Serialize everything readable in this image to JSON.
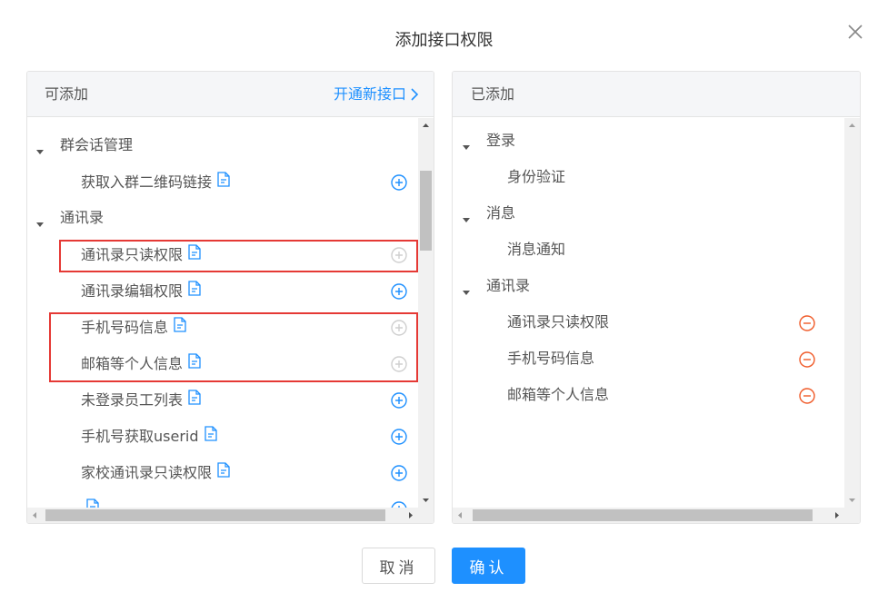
{
  "dialog": {
    "title": "添加接口权限",
    "cancel_label": "取消",
    "confirm_label": "确认"
  },
  "left_panel": {
    "title": "可添加",
    "link_label": "开通新接口",
    "rows": [
      {
        "type": "item",
        "label": "",
        "addable": true
      },
      {
        "type": "group",
        "label": "群会话管理"
      },
      {
        "type": "item",
        "label": "获取入群二维码链接",
        "addable": true
      },
      {
        "type": "group",
        "label": "通讯录"
      },
      {
        "type": "item",
        "label": "通讯录只读权限",
        "addable": false
      },
      {
        "type": "item",
        "label": "通讯录编辑权限",
        "addable": true
      },
      {
        "type": "item",
        "label": "手机号码信息",
        "addable": false
      },
      {
        "type": "item",
        "label": "邮箱等个人信息",
        "addable": false
      },
      {
        "type": "item",
        "label": "未登录员工列表",
        "addable": true
      },
      {
        "type": "item",
        "label": "手机号获取userid",
        "addable": true
      },
      {
        "type": "item",
        "label": "家校通讯录只读权限",
        "addable": true
      },
      {
        "type": "item",
        "label": "",
        "addable": true
      }
    ]
  },
  "right_panel": {
    "title": "已添加",
    "rows": [
      {
        "type": "group",
        "label": "登录"
      },
      {
        "type": "item",
        "label": "身份验证",
        "removable": false
      },
      {
        "type": "group",
        "label": "消息"
      },
      {
        "type": "item",
        "label": "消息通知",
        "removable": false
      },
      {
        "type": "group",
        "label": "通讯录"
      },
      {
        "type": "item",
        "label": "通讯录只读权限",
        "removable": true
      },
      {
        "type": "item",
        "label": "手机号码信息",
        "removable": true
      },
      {
        "type": "item",
        "label": "邮箱等个人信息",
        "removable": true
      }
    ]
  },
  "colors": {
    "accent": "#1e90ff",
    "remove": "#f05a28",
    "disabled": "#cfcfcf",
    "highlight": "#e53935"
  }
}
